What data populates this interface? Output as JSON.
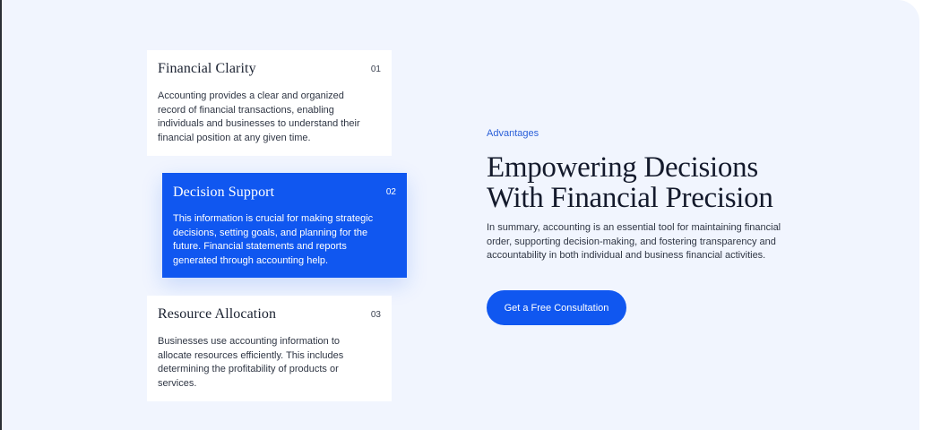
{
  "cards": [
    {
      "title": "Financial Clarity",
      "number": "01",
      "description": "Accounting provides a clear and organized record of financial transactions, enabling individuals and businesses to understand their financial position at any given time."
    },
    {
      "title": "Decision Support",
      "number": "02",
      "description": "This information is crucial for making strategic decisions, setting goals, and planning for the future. Financial statements and reports generated through accounting help."
    },
    {
      "title": "Resource Allocation",
      "number": "03",
      "description": "Businesses use accounting information to allocate resources efficiently. This includes determining the profitability of products or services."
    }
  ],
  "section": {
    "eyebrow": "Advantages",
    "heading": "Empowering Decisions With Financial Precision",
    "summary": "In summary, accounting is an essential tool for maintaining financial order, supporting decision-making, and fostering transparency and accountability in both individual and business financial activities.",
    "cta_label": "Get a Free Consultation"
  },
  "colors": {
    "accent": "#1057f0",
    "panel_background": "#f1f5fe",
    "text_dark": "#141a2c"
  }
}
